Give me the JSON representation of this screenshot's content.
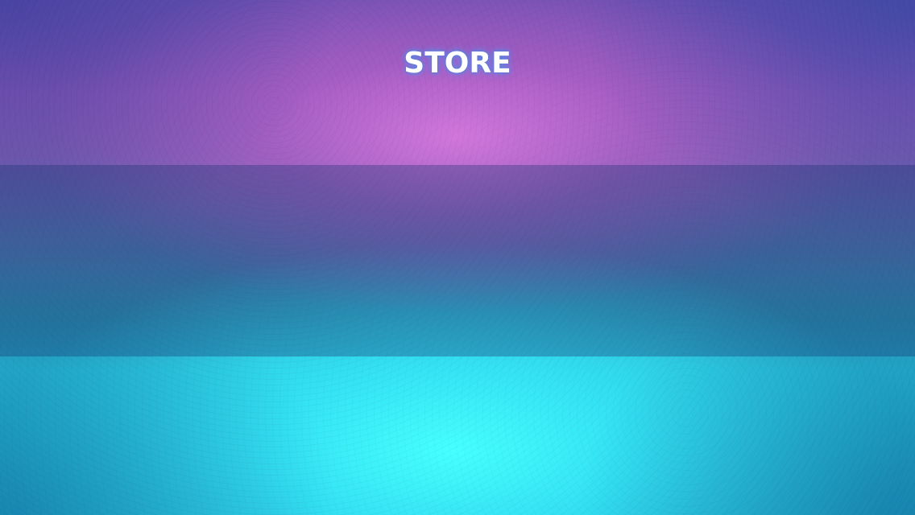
{
  "screen": {
    "title": "STORE"
  },
  "colors": {
    "top_glow": "#d678de",
    "bottom_glow": "#46ffff",
    "title_text": "#ffffff",
    "title_glow": "#5a78d8",
    "band_tint": "#14326e"
  }
}
